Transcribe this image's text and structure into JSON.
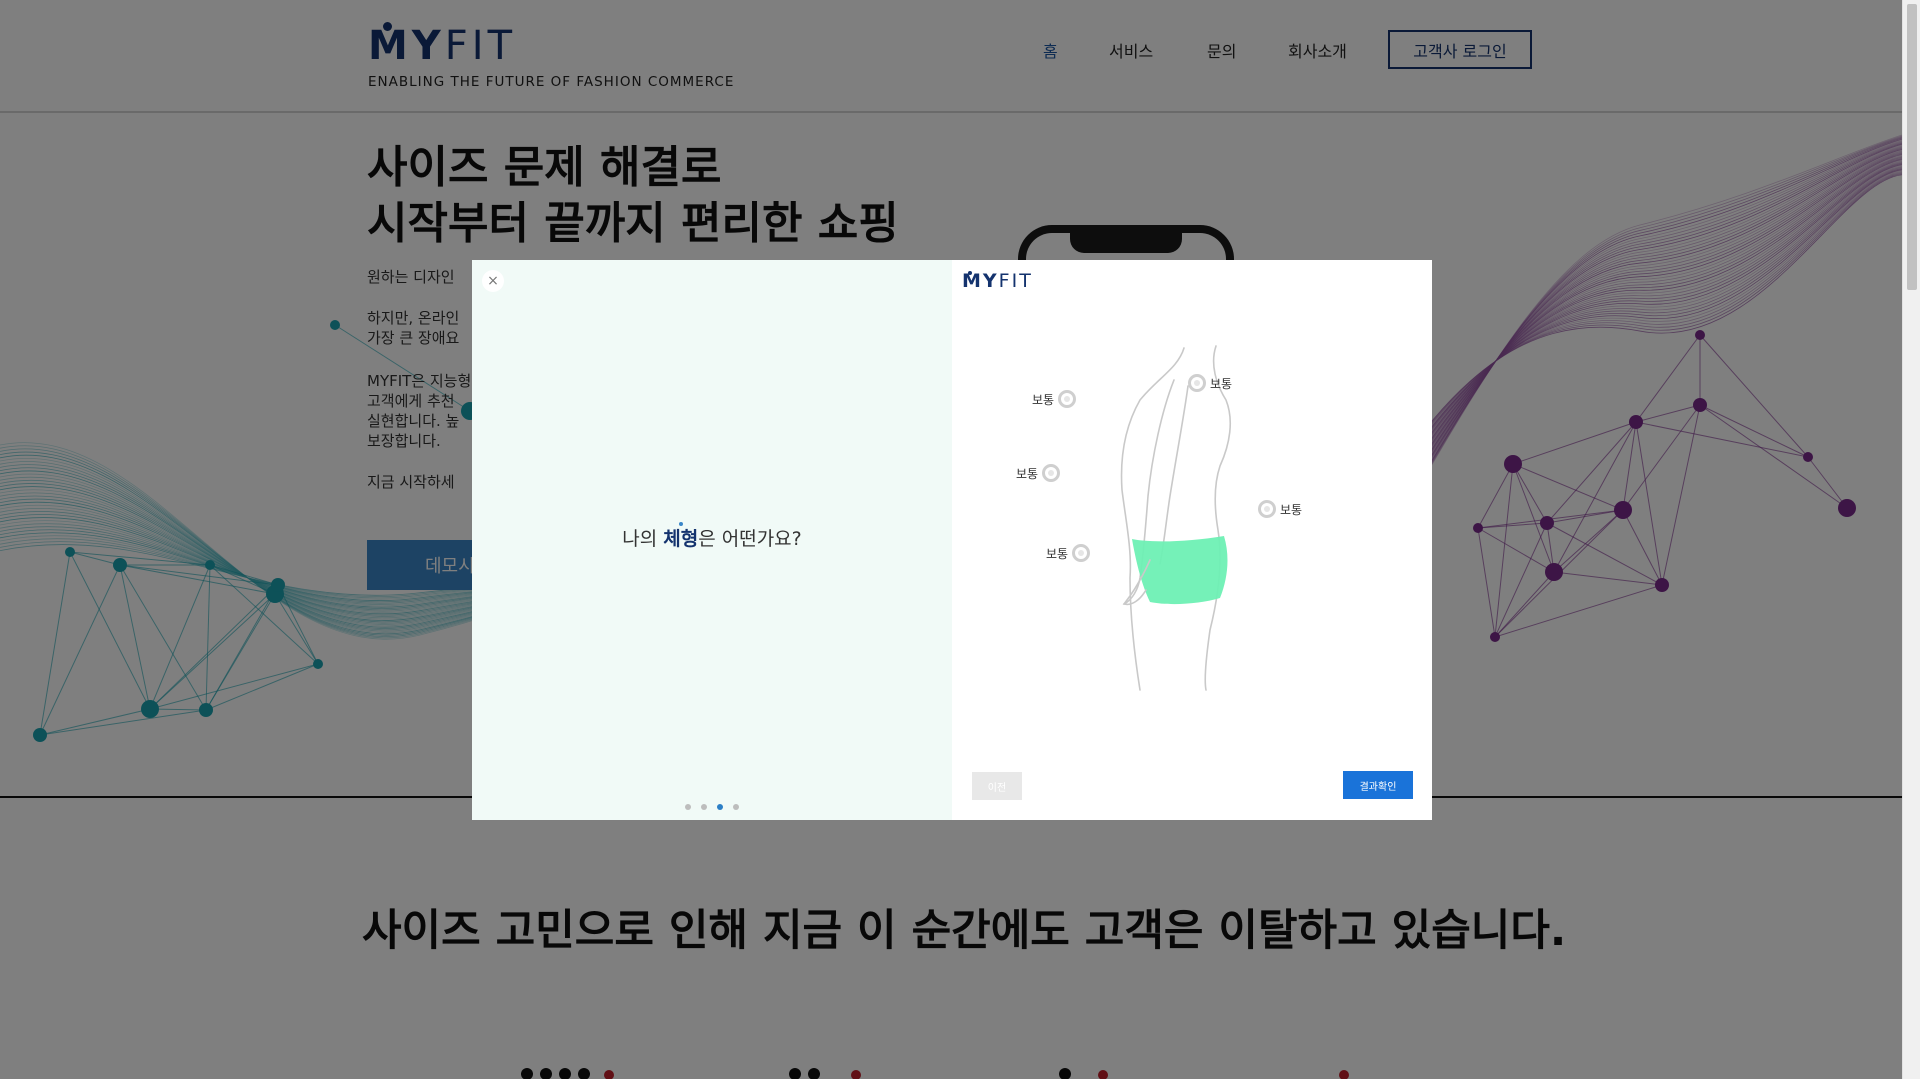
{
  "header": {
    "logo_text_bold": "MY",
    "logo_text_light": "FIT",
    "tagline": "ENABLING THE FUTURE OF FASHION COMMERCE",
    "nav": [
      {
        "label": "홈",
        "active": true
      },
      {
        "label": "서비스",
        "active": false
      },
      {
        "label": "문의",
        "active": false
      },
      {
        "label": "회사소개",
        "active": false
      }
    ],
    "login_label": "고객사 로그인"
  },
  "hero": {
    "title_line1": "사이즈 문제 해결로",
    "title_line2": "시작부터 끝까지 편리한 쇼핑",
    "para1": "원하는 디자인",
    "para2_line1": "하지만, 온라인",
    "para2_line2": "가장 큰 장애요",
    "para3_line1": "MYFIT은 지능형",
    "para3_line2": "고객에게 추천",
    "para3_line3": "실현합니다. 높",
    "para3_line4": "보장합니다.",
    "para4": "지금 시작하세",
    "demo_label": "데모시"
  },
  "section2": {
    "title": "사이즈 고민으로 인해 지금 이 순간에도 고객은 이탈하고 있습니다."
  },
  "modal": {
    "close_glyph": "×",
    "question_prefix": "나의 ",
    "question_highlight": "체형",
    "question_suffix": "은 어떤가요?",
    "pager": {
      "total": 4,
      "active_index": 2
    },
    "logo_bold": "MY",
    "logo_light": "FIT",
    "markers": [
      {
        "id": "chest",
        "label": "보통"
      },
      {
        "id": "back",
        "label": "보통"
      },
      {
        "id": "waist",
        "label": "보통"
      },
      {
        "id": "hip",
        "label": "보통"
      },
      {
        "id": "thigh",
        "label": "보통"
      }
    ],
    "prev_label": "이전",
    "result_label": "결과확인"
  },
  "colors": {
    "brand_navy": "#14336e",
    "accent_blue": "#1a73d9",
    "hip_highlight": "#6ef0b4",
    "modal_left_bg": "#f1faf7",
    "teal_wave": "#1aa3b0",
    "purple_wave": "#7a2a8c"
  }
}
